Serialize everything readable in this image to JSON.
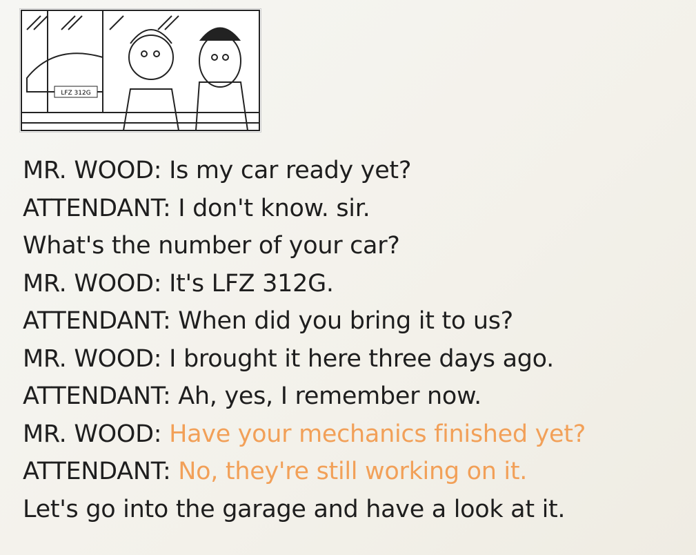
{
  "illustration": {
    "plate": "LFZ 312G"
  },
  "colors": {
    "text": "#1e1e1e",
    "highlight": "#f2a058"
  },
  "dialog": [
    {
      "speaker": "MR. WOOD:",
      "text": "Is my car ready yet?",
      "highlight": ""
    },
    {
      "speaker": "ATTENDANT:",
      "text": "I don't know. sir.",
      "highlight": ""
    },
    {
      "speaker": "",
      "text": "What's the number of your car?",
      "highlight": ""
    },
    {
      "speaker": "MR. WOOD:",
      "text": "It's LFZ 312G.",
      "highlight": ""
    },
    {
      "speaker": "ATTENDANT:",
      "text": "When did you bring it to us?",
      "highlight": ""
    },
    {
      "speaker": "MR. WOOD:",
      "text": "I brought it here three days ago.",
      "highlight": ""
    },
    {
      "speaker": "ATTENDANT:",
      "text": "Ah, yes, I remember now.",
      "highlight": ""
    },
    {
      "speaker": "MR. WOOD:",
      "text": "",
      "highlight": "Have your mechanics finished yet?"
    },
    {
      "speaker": "ATTENDANT:",
      "text": "",
      "highlight": "No, they're still working on it."
    },
    {
      "speaker": "",
      "text": "Let's go into the garage and have a look at it.",
      "highlight": ""
    }
  ]
}
